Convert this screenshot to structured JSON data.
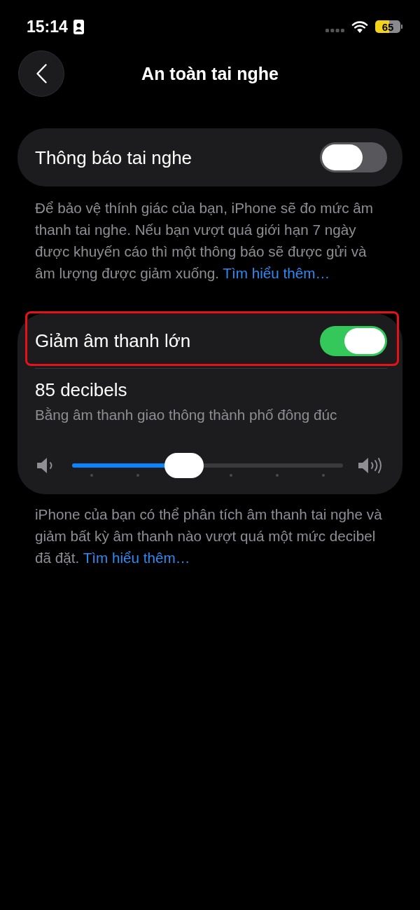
{
  "status_bar": {
    "time": "15:14",
    "battery": "65"
  },
  "nav": {
    "title": "An toàn tai nghe"
  },
  "sections": [
    {
      "rows": [
        {
          "kind": "toggle",
          "label": "Thông báo tai nghe",
          "on": false,
          "highlighted": false
        }
      ],
      "footer": {
        "text": "Để bảo vệ thính giác của bạn, iPhone sẽ đo mức âm thanh tai nghe. Nếu bạn vượt quá giới hạn 7 ngày được khuyến cáo thì một thông báo sẽ được gửi và âm lượng được giảm xuống.",
        "link": "Tìm hiểu thêm…"
      }
    },
    {
      "rows": [
        {
          "kind": "toggle",
          "label": "Giảm âm thanh lớn",
          "on": true,
          "highlighted": true
        },
        {
          "kind": "slider",
          "title": "85 decibels",
          "subtitle": "Bằng âm thanh giao thông thành phố đông đúc",
          "level": 0.4
        }
      ],
      "footer": {
        "text": "iPhone của bạn có thể phân tích âm thanh tai nghe và giảm bất kỳ âm thanh nào vượt quá một mức decibel đã đặt.",
        "link": "Tìm hiểu thêm…"
      }
    }
  ]
}
